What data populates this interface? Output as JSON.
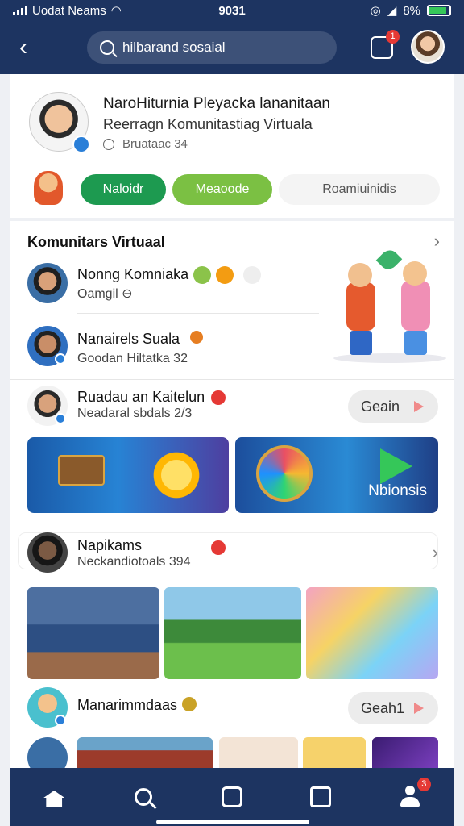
{
  "status": {
    "carrier": "Uodat Neams",
    "time": "9031",
    "battery": "8%"
  },
  "header": {
    "search_text": "hilbarand sosaial",
    "notify_badge": "1"
  },
  "profile": {
    "name": "NaroHiturnia Pleyacka lananitaan",
    "subtitle": "Reerragn Komunitastiag Virtuala",
    "meta": "Bruataac 34",
    "pills": [
      "Naloidr",
      "Meaoode",
      "Roamiuinidis"
    ]
  },
  "feed": {
    "section_title": "Komunitars Virtuaal",
    "rows": [
      {
        "name": "Nonng Komniaka",
        "sub": "Oamgil ⊖"
      },
      {
        "name": "Nanairels Suala",
        "sub": "Goodan Hiltatka 32"
      },
      {
        "name": "Ruadau an Kaitelun",
        "sub": "Neadaral sbdals 2/3",
        "action": "Geain"
      }
    ],
    "banners": [
      "Nbionsis"
    ],
    "card": {
      "name": "Napikams",
      "sub": "Neckandiotoals 394"
    },
    "community": {
      "name": "Manarimmdaas",
      "action": "Geah1"
    }
  },
  "tabbar": {
    "profile_badge": "3"
  },
  "colors": {
    "brand": "#1d3461",
    "green": "#1d9a50",
    "light_green": "#7bc043",
    "badge": "#e53935"
  }
}
